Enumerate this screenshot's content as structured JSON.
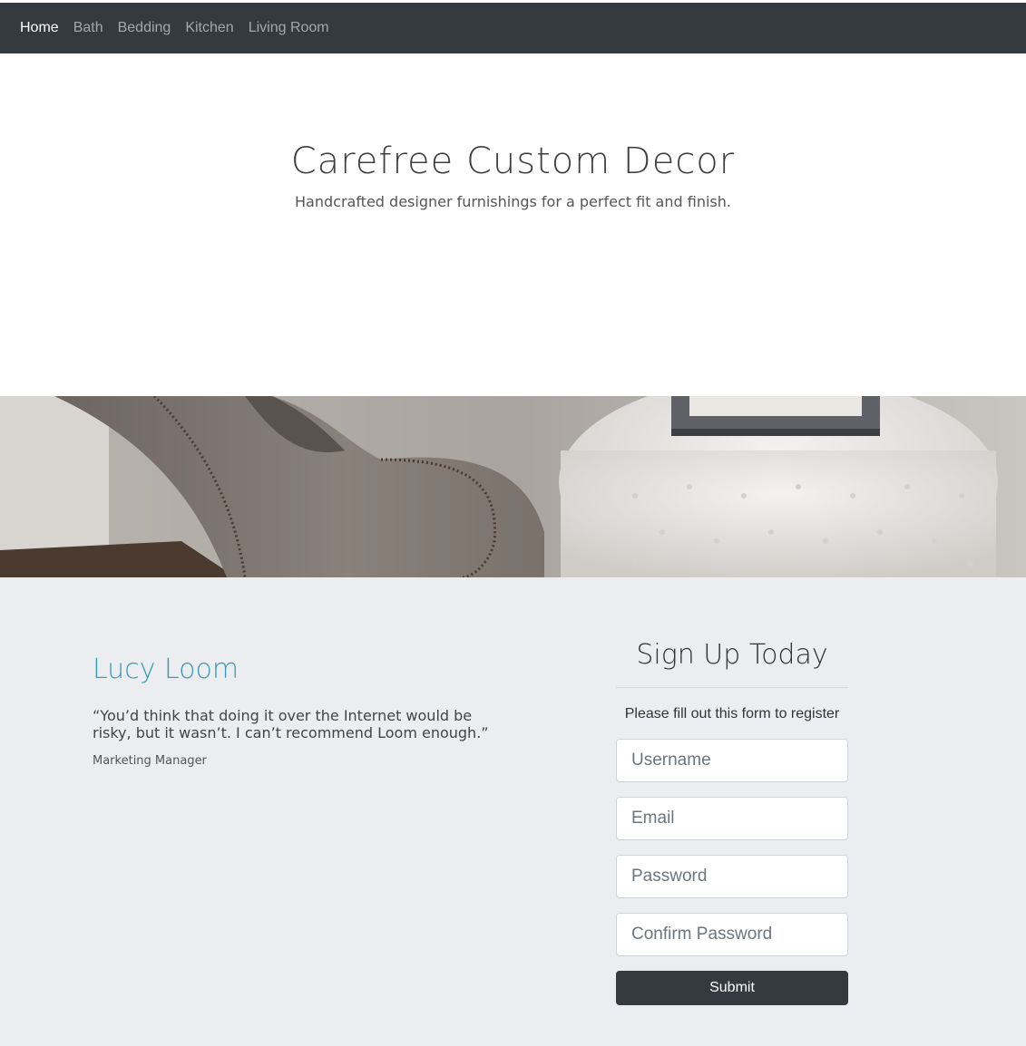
{
  "nav": {
    "items": [
      {
        "label": "Home",
        "active": true
      },
      {
        "label": "Bath"
      },
      {
        "label": "Bedding"
      },
      {
        "label": "Kitchen"
      },
      {
        "label": "Living Room"
      }
    ]
  },
  "hero": {
    "title": "Carefree Custom Decor",
    "subtitle": "Handcrafted designer furnishings for a perfect fit and finish."
  },
  "banner": {
    "image": "living-room-chair-and-tufted-ottoman-photo"
  },
  "testimonial": {
    "name": "Lucy Loom",
    "quote": "“You’d think that doing it over the Internet would be risky, but it wasn’t. I can’t recommend Loom enough.”",
    "role": "Marketing Manager"
  },
  "signup": {
    "title": "Sign Up Today",
    "instructions": "Please fill out this form to register",
    "fields": [
      {
        "placeholder": "Username"
      },
      {
        "placeholder": "Email"
      },
      {
        "placeholder": "Password"
      },
      {
        "placeholder": "Confirm Password"
      }
    ],
    "submit_label": "Submit"
  },
  "colors": {
    "navbar": "#343a40",
    "accent": "#3a9bb5",
    "section_bg": "#ecedf0",
    "button": "#343a40"
  }
}
